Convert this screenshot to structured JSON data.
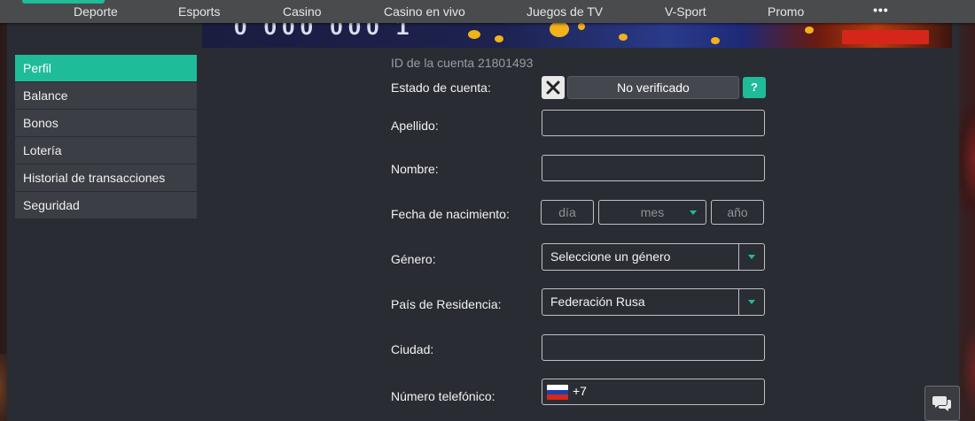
{
  "nav": {
    "items": [
      {
        "label": "Deporte"
      },
      {
        "label": "Esports"
      },
      {
        "label": "Casino"
      },
      {
        "label": "Casino en vivo"
      },
      {
        "label": "Juegos de TV"
      },
      {
        "label": "V-Sport"
      },
      {
        "label": "Promo"
      }
    ],
    "more_label": "•••"
  },
  "sidebar": {
    "items": [
      {
        "label": "Perfil",
        "active": true
      },
      {
        "label": "Balance"
      },
      {
        "label": "Bonos"
      },
      {
        "label": "Lotería"
      },
      {
        "label": "Historial de transacciones"
      },
      {
        "label": "Seguridad"
      }
    ]
  },
  "form": {
    "account_id": "ID de la cuenta 21801493",
    "status_label": "Estado de cuenta:",
    "status_value": "No verificado",
    "help_label": "?",
    "surname_label": "Apellido:",
    "surname_value": "",
    "name_label": "Nombre:",
    "name_value": "",
    "birthdate_label": "Fecha de nacimiento:",
    "day_placeholder": "día",
    "month_placeholder": "mes",
    "year_placeholder": "año",
    "gender_label": "Género:",
    "gender_value": "Seleccione un género",
    "country_label": "País de Residencia:",
    "country_value": "Federación Rusa",
    "city_label": "Ciudad:",
    "city_value": "",
    "phone_label": "Número telefónico:",
    "phone_code": "+7"
  },
  "colors": {
    "accent": "#1fbc9a",
    "nav_bg": "#4a4b4d",
    "panel_bg": "#2a2c33",
    "sidebar_item_bg": "#3c3e45"
  },
  "icons": {
    "status": "close-x-icon",
    "chat": "chat-bubbles-icon",
    "flag": "russia-flag-icon"
  }
}
